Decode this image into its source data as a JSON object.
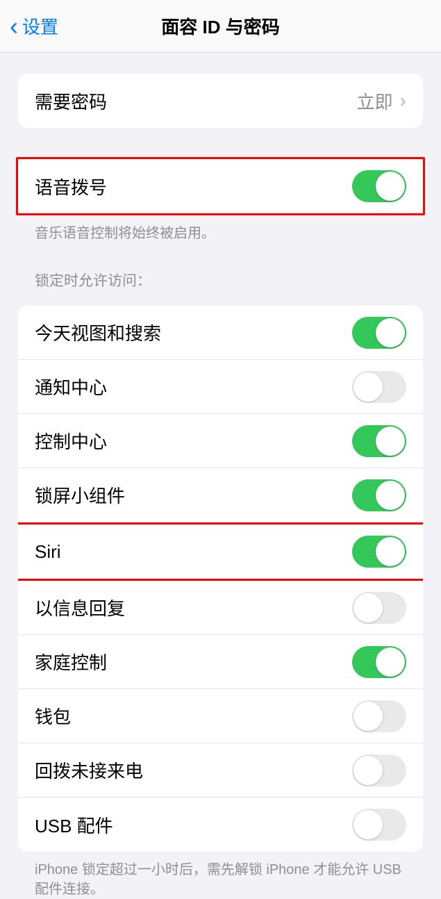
{
  "header": {
    "back_label": "设置",
    "title": "面容 ID 与密码"
  },
  "passcode": {
    "label": "需要密码",
    "value": "立即"
  },
  "voice_dial": {
    "label": "语音拨号",
    "on": true,
    "footer": "音乐语音控制将始终被启用。"
  },
  "lock_access": {
    "header": "锁定时允许访问：",
    "items": [
      {
        "label": "今天视图和搜索",
        "on": true,
        "highlighted": false
      },
      {
        "label": "通知中心",
        "on": false,
        "highlighted": false
      },
      {
        "label": "控制中心",
        "on": true,
        "highlighted": false
      },
      {
        "label": "锁屏小组件",
        "on": true,
        "highlighted": false
      },
      {
        "label": "Siri",
        "on": true,
        "highlighted": true
      },
      {
        "label": "以信息回复",
        "on": false,
        "highlighted": false
      },
      {
        "label": "家庭控制",
        "on": true,
        "highlighted": false
      },
      {
        "label": "钱包",
        "on": false,
        "highlighted": false
      },
      {
        "label": "回拨未接来电",
        "on": false,
        "highlighted": false
      },
      {
        "label": "USB 配件",
        "on": false,
        "highlighted": false
      }
    ],
    "footer": "iPhone 锁定超过一小时后，需先解锁 iPhone 才能允许 USB 配件连接。"
  }
}
